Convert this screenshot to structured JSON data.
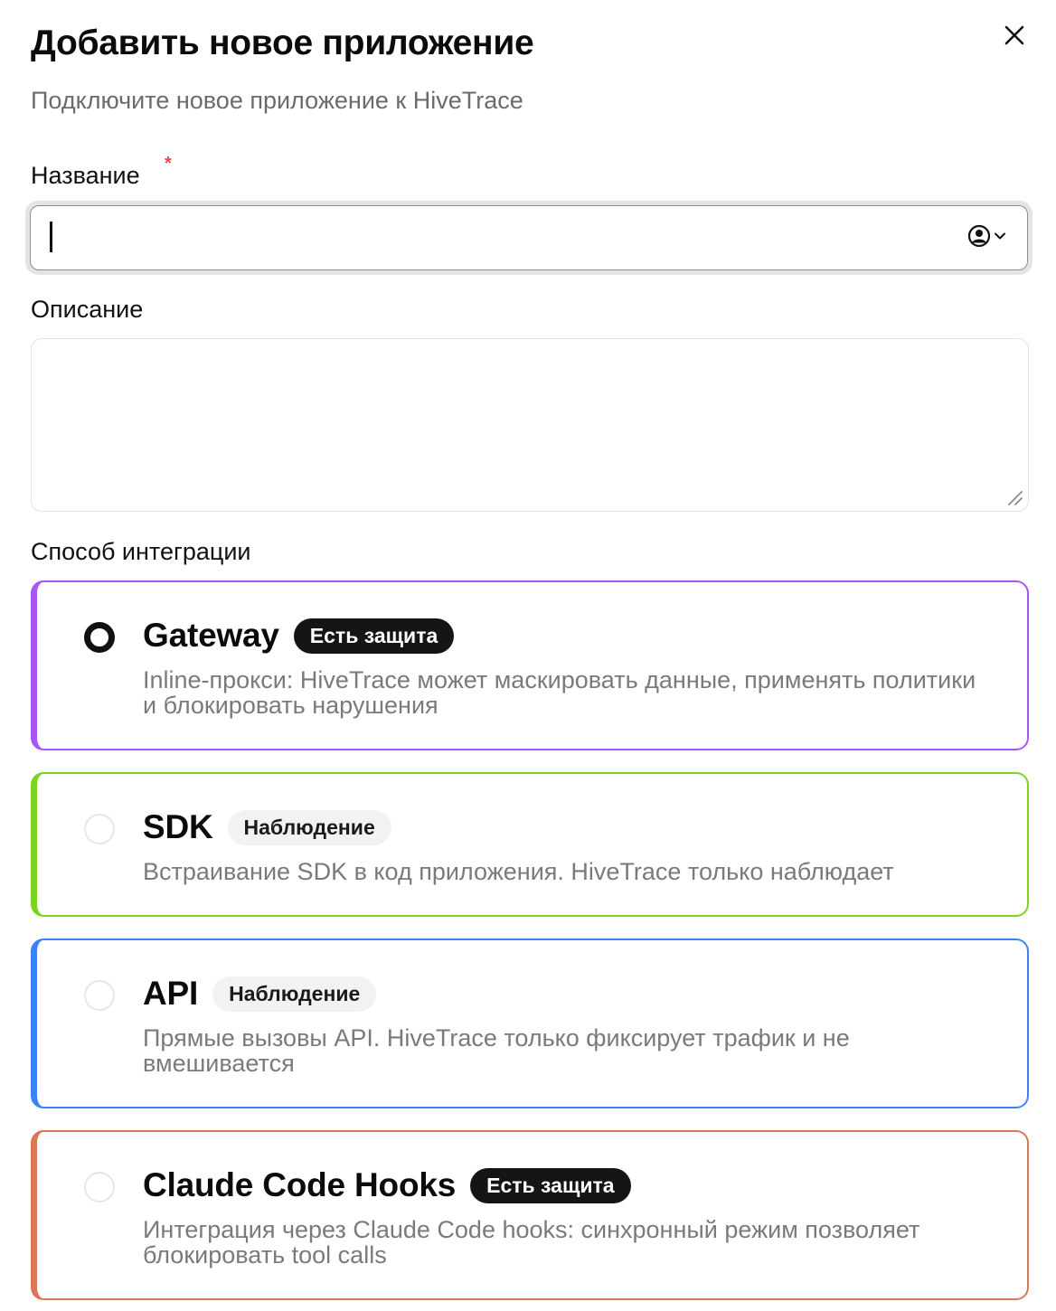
{
  "dialog": {
    "title": "Добавить новое приложение",
    "subtitle": "Подключите новое приложение к HiveTrace",
    "close_icon": "close-icon"
  },
  "form": {
    "name_label": "Название",
    "name_required_mark": "*",
    "name_value": "",
    "name_placeholder": "",
    "name_picker_icon": "user-circle-icon",
    "description_label": "Описание",
    "description_value": "",
    "integration_label": "Способ интеграции"
  },
  "integration_options": [
    {
      "title": "Gateway",
      "badge": "Есть защита",
      "badge_style": "dark",
      "description": "Inline-прокси: HiveTrace может маскировать данные, применять политики и блокировать нарушения",
      "selected": true,
      "accent_color": "#a855f7"
    },
    {
      "title": "SDK",
      "badge": "Наблюдение",
      "badge_style": "light",
      "description": "Встраивание SDK в код приложения. HiveTrace только наблюдает",
      "selected": false,
      "accent_color": "#7ed321"
    },
    {
      "title": "API",
      "badge": "Наблюдение",
      "badge_style": "light",
      "description": "Прямые вызовы API. HiveTrace только фиксирует трафик и не вмешивается",
      "selected": false,
      "accent_color": "#3b82f6"
    },
    {
      "title": "Claude Code Hooks",
      "badge": "Есть защита",
      "badge_style": "dark",
      "description": "Интеграция через Claude Code hooks: синхронный режим позволяет блокировать tool calls",
      "selected": false,
      "accent_color": "#d97757"
    }
  ],
  "colors": {
    "required": "#e5484d",
    "muted_text": "#6b6b6b"
  }
}
